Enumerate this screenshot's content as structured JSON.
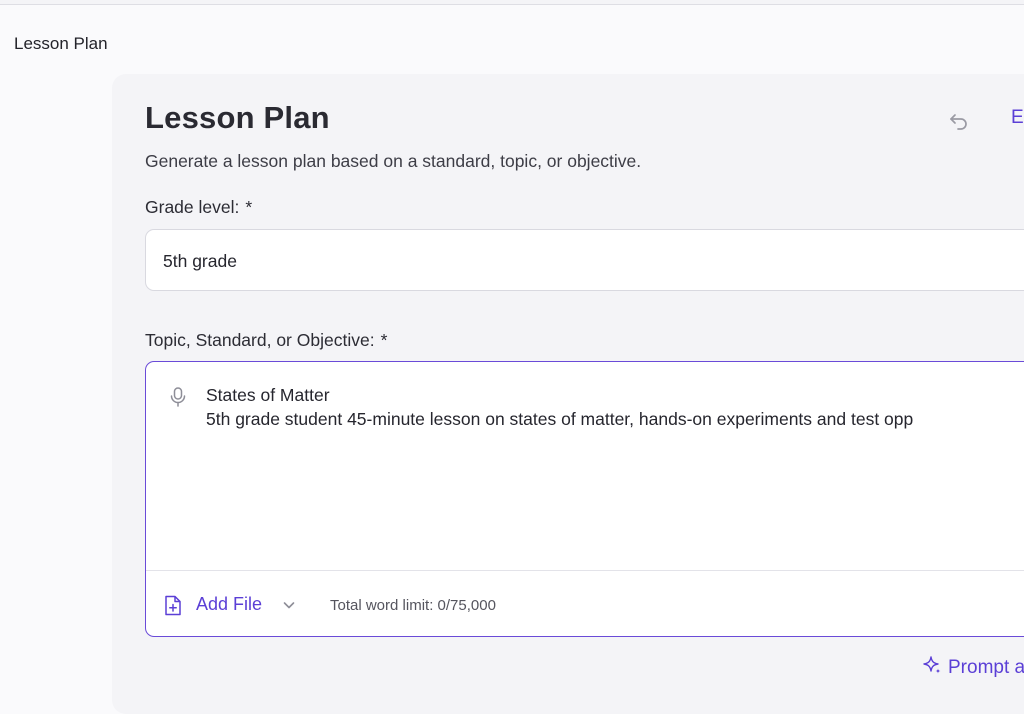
{
  "breadcrumb": "Lesson Plan",
  "page": {
    "title": "Lesson Plan",
    "subtitle": "Generate a lesson plan based on a standard, topic, or objective.",
    "export_label": "E"
  },
  "grade": {
    "label": "Grade level:",
    "required_mark": "*",
    "value": "5th grade"
  },
  "topic": {
    "label": "Topic, Standard, or Objective:",
    "required_mark": "*",
    "line1": "States of Matter",
    "line2": "5th grade student 45-minute lesson on states of matter, hands-on experiments and test opp"
  },
  "footer": {
    "add_file_label": "Add File",
    "word_limit": "Total word limit: 0/75,000"
  },
  "prompt_label": "Prompt a",
  "colors": {
    "accent": "#5b3fd6",
    "focus_border": "#6a4bd8"
  },
  "icons": [
    "undo-icon",
    "microphone-icon",
    "file-plus-icon",
    "chevron-down-icon",
    "sparkle-icon"
  ]
}
